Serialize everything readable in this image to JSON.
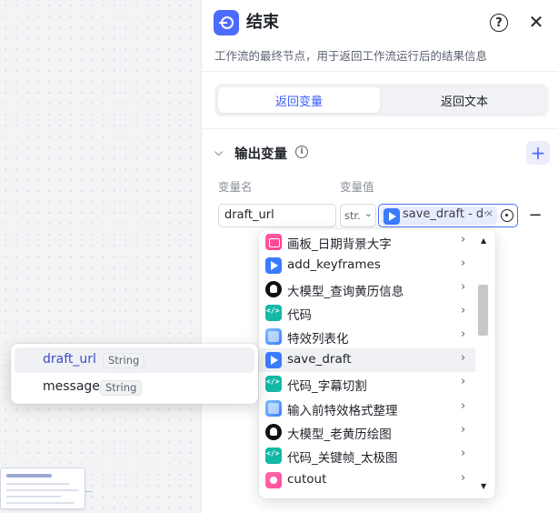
{
  "panel": {
    "title": "结束",
    "description": "工作流的最终节点，用于返回工作流运行后的结果信息",
    "help_label": "?",
    "close_label": "✕"
  },
  "tabs": [
    {
      "label": "返回变量",
      "active": true
    },
    {
      "label": "返回文本",
      "active": false
    }
  ],
  "output_section": {
    "title": "输出变量",
    "add_label": "+",
    "columns": {
      "name": "变量名",
      "value": "变量值"
    },
    "row": {
      "name": "draft_url",
      "type": "str.",
      "ref": "save_draft - d·",
      "ref_remove": "×",
      "remove_label": "−"
    }
  },
  "node_menu": {
    "items": [
      {
        "icon": "drawing-board-icon",
        "label": "画板_日期背景大字"
      },
      {
        "icon": "plugin-icon",
        "label": "add_keyframes"
      },
      {
        "icon": "llm-icon",
        "label": "大模型_查询黄历信息"
      },
      {
        "icon": "code-icon",
        "label": "代码"
      },
      {
        "icon": "image-icon",
        "label": "特效列表化"
      },
      {
        "icon": "plugin-icon",
        "label": "save_draft",
        "active": true
      },
      {
        "icon": "code-icon",
        "label": "代码_字幕切割"
      },
      {
        "icon": "image-icon",
        "label": "输入前特效格式整理"
      },
      {
        "icon": "llm-icon",
        "label": "大模型_老黄历绘图"
      },
      {
        "icon": "code-icon",
        "label": "代码_关键帧_太极图"
      },
      {
        "icon": "cutout-icon",
        "label": "cutout"
      }
    ]
  },
  "output_popup": {
    "items": [
      {
        "name": "draft_url",
        "type": "String",
        "selected": true
      },
      {
        "name": "message",
        "type": "String",
        "selected": false
      }
    ]
  },
  "colors": {
    "accent": "#4c6bff",
    "active_tab_text": "#3a5cff",
    "selected_output": "#3a4cc9"
  }
}
